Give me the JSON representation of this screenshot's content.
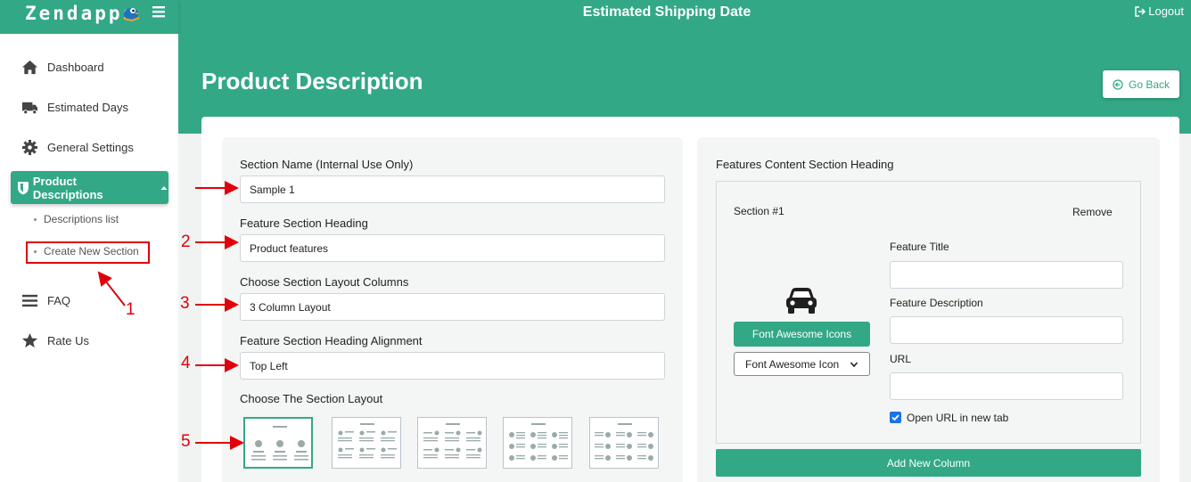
{
  "header": {
    "logo_text": "Zendapps",
    "title": "Estimated Shipping Date",
    "logout_label": "Logout"
  },
  "sidebar": {
    "items": [
      {
        "label": "Dashboard",
        "icon": "home-icon"
      },
      {
        "label": "Estimated Days",
        "icon": "truck-icon"
      },
      {
        "label": "General Settings",
        "icon": "gear-icon"
      },
      {
        "label": "Product Descriptions",
        "icon": "shield-icon",
        "active": true
      },
      {
        "label": "FAQ",
        "icon": "list-icon"
      },
      {
        "label": "Rate Us",
        "icon": "star-icon"
      }
    ],
    "subitems": [
      {
        "label": "Descriptions list"
      },
      {
        "label": "Create New Section"
      }
    ]
  },
  "page": {
    "title": "Product Description",
    "go_back_label": "Go Back"
  },
  "form": {
    "section_name_label": "Section Name (Internal Use Only)",
    "section_name_value": "Sample 1",
    "heading_label": "Feature Section Heading",
    "heading_value": "Product features",
    "columns_label": "Choose Section Layout Columns",
    "columns_value": "3 Column Layout",
    "alignment_label": "Feature Section Heading Alignment",
    "alignment_value": "Top Left",
    "layout_label": "Choose The Section Layout",
    "selected_layout_index": 0
  },
  "features": {
    "heading": "Features Content Section Heading",
    "section_title": "Section #1",
    "remove_label": "Remove",
    "icon": "car-icon",
    "icons_button_label": "Font Awesome Icons",
    "icon_select_value": "Font Awesome Icon",
    "feature_title_label": "Feature Title",
    "feature_title_value": "",
    "feature_description_label": "Feature Description",
    "feature_description_value": "",
    "url_label": "URL",
    "url_value": "",
    "open_new_tab_label": "Open URL in new tab",
    "open_new_tab_checked": true,
    "add_column_label": "Add New Column"
  },
  "annotations": {
    "labels": [
      "1",
      "2",
      "3",
      "4",
      "5"
    ],
    "color": "#e0000b"
  },
  "colors": {
    "accent": "#32a887"
  }
}
